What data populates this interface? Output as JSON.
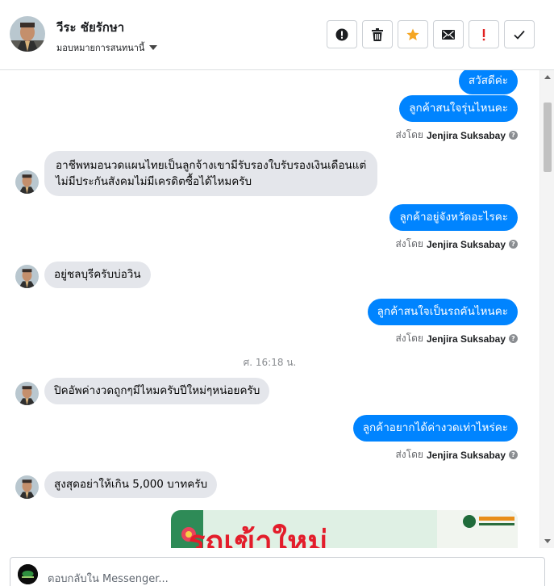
{
  "header": {
    "contact_name": "วีระ ชัยรักษา",
    "assign_label": "มอบหมายการสนทนานี้",
    "actions": [
      {
        "icon": "alert-circle-icon"
      },
      {
        "icon": "trash-icon"
      },
      {
        "icon": "star-icon"
      },
      {
        "icon": "mail-icon"
      },
      {
        "icon": "exclamation-icon"
      },
      {
        "icon": "check-icon"
      }
    ]
  },
  "messages": {
    "m1": "สวัสดีค่ะ",
    "m2": "ลูกค้าสนใจรุ่นไหนคะ",
    "m3_line1": "อาชีพหมอนวดแผนไทยเป็นลูกจ้างเขามีรับรองใบรับรองเงินเดือนแต่",
    "m3_line2": "ไม่มีประกันสังคมไม่มีเครดิตซื้อได้ไหมครับ",
    "m4": "ลูกค้าอยู่จังหวัดอะไรคะ",
    "m5": "อยู่ชลบุรีครับบ่อวิน",
    "m6": "ลูกค้าสนใจเป็นรถคันไหนคะ",
    "timestamp": "ศ. 16:18 น.",
    "m7": "ปิคอัพค่างวดถูกๆมีไหมครับปีใหม่ๆหน่อยครับ",
    "m8": "ลูกค้าอยากได้ค่างวดเท่าไหร่คะ",
    "m9": "สูงสุดอย่าให้เกิน 5,000 บาทครับ",
    "image_text": "รถเข้าใหม่"
  },
  "sent_by": {
    "prefix": "ส่งโดย",
    "agent": "Jenjira Suksabay"
  },
  "composer": {
    "placeholder": "ตอบกลับใน Messenger..."
  },
  "colors": {
    "outgoing_bubble": "#0084ff",
    "incoming_bubble": "#e4e6eb",
    "star": "#f5a623",
    "exclamation": "#e02020"
  }
}
